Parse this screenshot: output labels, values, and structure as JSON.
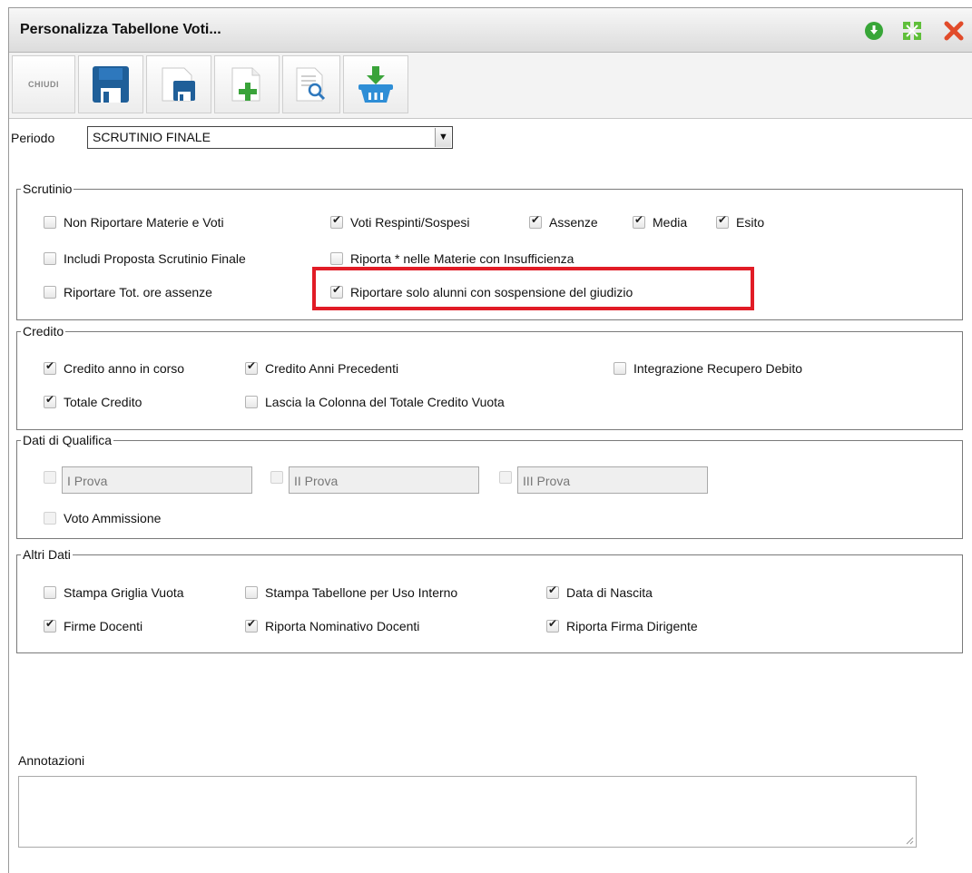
{
  "window": {
    "title": "Personalizza Tabellone Voti..."
  },
  "toolbar": {
    "close_label": "CHIUDI"
  },
  "periodo": {
    "label": "Periodo",
    "value": "SCRUTINIO FINALE"
  },
  "scrutinio": {
    "legend": "Scrutinio",
    "items": [
      {
        "label": "Non Riportare Materie e Voti",
        "checked": false
      },
      {
        "label": "Voti Respinti/Sospesi",
        "checked": true
      },
      {
        "label": "Assenze",
        "checked": true
      },
      {
        "label": "Media",
        "checked": true
      },
      {
        "label": "Esito",
        "checked": true
      },
      {
        "label": "Includi Proposta Scrutinio Finale",
        "checked": false
      },
      {
        "label": "Riporta * nelle Materie con Insufficienza",
        "checked": false
      },
      {
        "label": "Riportare Tot. ore assenze",
        "checked": false
      },
      {
        "label": "Riportare solo alunni con sospensione del giudizio",
        "checked": true
      }
    ]
  },
  "credito": {
    "legend": "Credito",
    "items": [
      {
        "label": "Credito anno in corso",
        "checked": true
      },
      {
        "label": "Credito Anni Precedenti",
        "checked": true
      },
      {
        "label": "Integrazione Recupero Debito",
        "checked": false
      },
      {
        "label": "Totale Credito",
        "checked": true
      },
      {
        "label": "Lascia la Colonna del Totale Credito Vuota",
        "checked": false
      }
    ]
  },
  "qualifica": {
    "legend": "Dati di Qualifica",
    "prove": [
      {
        "placeholder": "I Prova"
      },
      {
        "placeholder": "II Prova"
      },
      {
        "placeholder": "III Prova"
      }
    ],
    "voto_ammissione": "Voto Ammissione"
  },
  "altri": {
    "legend": "Altri Dati",
    "items": [
      {
        "label": "Stampa Griglia Vuota",
        "checked": false
      },
      {
        "label": "Stampa Tabellone per Uso Interno",
        "checked": false
      },
      {
        "label": "Data di Nascita",
        "checked": true
      },
      {
        "label": "Firme Docenti",
        "checked": true
      },
      {
        "label": "Riporta Nominativo Docenti",
        "checked": true
      },
      {
        "label": "Riporta Firma Dirigente",
        "checked": true
      }
    ]
  },
  "annotazioni": {
    "label": "Annotazioni",
    "value": ""
  },
  "colors": {
    "highlight": "#e11c26",
    "title_bar": "#dcdcdc",
    "save_icon": "#1f5f99",
    "add_icon": "#3aa33a",
    "close_icon": "#e14b2a"
  }
}
